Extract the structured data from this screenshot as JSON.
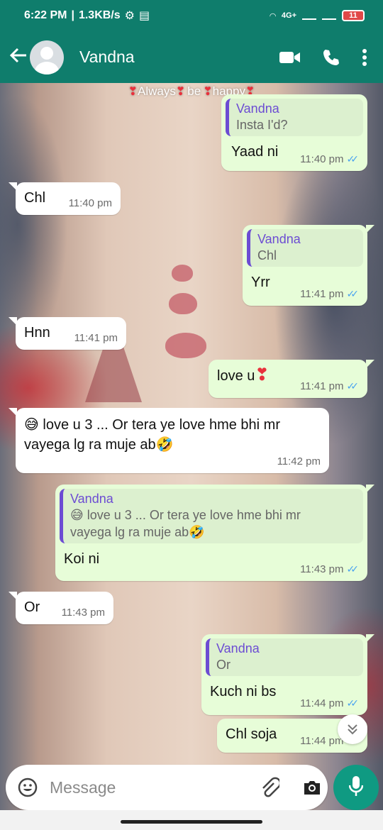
{
  "status_bar": {
    "time": "6:22 PM",
    "speed": "1.3KB/s",
    "network": "4G+",
    "battery": "11"
  },
  "header": {
    "back_icon": "arrow-left-icon",
    "contact_name": "Vandna",
    "icons": [
      "video-call-icon",
      "phone-icon",
      "more-vert-icon"
    ],
    "color": "#0f7d6c"
  },
  "banner": {
    "w1": "Always",
    "w2": "be",
    "w3": "happy",
    "heart": "❣"
  },
  "messages": [
    {
      "dir": "out",
      "quote_name": "Vandna",
      "quote_text": "Insta I'd?",
      "text": "Yaad ni",
      "time": "11:40 pm",
      "ticks": "✓✓"
    },
    {
      "dir": "in",
      "text": "Chl",
      "time": "11:40 pm"
    },
    {
      "dir": "out",
      "quote_name": "Vandna",
      "quote_text": "Chl",
      "text": "Yrr",
      "time": "11:41 pm",
      "ticks": "✓✓"
    },
    {
      "dir": "in",
      "text": "Hnn",
      "time": "11:41 pm"
    },
    {
      "dir": "out",
      "text": "love u",
      "emoji": "❣",
      "time": "11:41 pm",
      "ticks": "✓✓"
    },
    {
      "dir": "in",
      "text_line1": "😅 love u 3 ... Or tera ye love hme bhi mr",
      "text_line2": "vayega lg ra muje ab🤣",
      "time": "11:42 pm"
    },
    {
      "dir": "out",
      "quote_name": "Vandna",
      "quote_line1": "😅 love u 3 ... Or tera ye love hme bhi mr",
      "quote_line2": "vayega lg ra muje ab🤣",
      "text": "Koi ni",
      "time": "11:43 pm",
      "ticks": "✓✓"
    },
    {
      "dir": "in",
      "text": "Or",
      "time": "11:43 pm"
    },
    {
      "dir": "out",
      "quote_name": "Vandna",
      "quote_text": "Or",
      "text": "Kuch ni bs",
      "time": "11:44 pm",
      "ticks": "✓✓"
    },
    {
      "dir": "out",
      "text": "Chl soja",
      "time": "11:44 pm",
      "ticks": "✓✓"
    }
  ],
  "scroll_down_icon": "double-chevron-down-icon",
  "input": {
    "placeholder": "Message",
    "emoji_icon": "emoji-icon",
    "attach_icon": "paperclip-icon",
    "camera_icon": "camera-icon",
    "mic_icon": "mic-icon"
  },
  "colors": {
    "outgoing_bubble": "#e7fdd8",
    "incoming_bubble": "#ffffff",
    "tick_blue": "#4aa3f0",
    "quote_accent": "#6c4cd3",
    "mic_button": "#0f9a82"
  }
}
